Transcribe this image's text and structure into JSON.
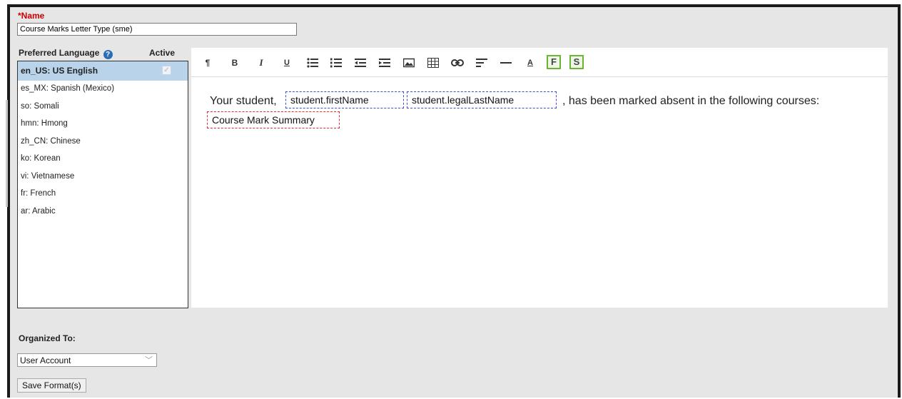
{
  "name": {
    "label": "*Name",
    "value": "Course Marks Letter Type (sme)"
  },
  "languages": {
    "header": "Preferred Language",
    "active_header": "Active",
    "items": [
      {
        "label": "en_US: US English",
        "selected": true,
        "active": true
      },
      {
        "label": "es_MX: Spanish (Mexico)"
      },
      {
        "label": "so: Somali"
      },
      {
        "label": "hmn: Hmong"
      },
      {
        "label": "zh_CN: Chinese"
      },
      {
        "label": "ko: Korean"
      },
      {
        "label": "vi: Vietnamese"
      },
      {
        "label": "fr: French"
      },
      {
        "label": "ar: Arabic"
      }
    ]
  },
  "toolbar": {
    "paragraph": "¶",
    "bold": "B",
    "italic": "I",
    "underline": "U",
    "text_color": "A",
    "field_button": "F",
    "sub_report_button": "S"
  },
  "content": {
    "text_before": "Your student,",
    "token_first_name": "student.firstName",
    "token_last_name": "student.legalLastName",
    "text_after": ", has been marked absent in the following courses:",
    "token_summary": "Course Mark Summary"
  },
  "organized": {
    "label": "Organized To:",
    "selected": "User Account"
  },
  "save_button": "Save Format(s)",
  "colors": {
    "required_label": "#cc0000",
    "selected_row": "#b9d3ea",
    "field_token_border": "#3b4fd6",
    "summary_token_border": "#e03030",
    "toolbar_highlight": "#6bb534"
  }
}
